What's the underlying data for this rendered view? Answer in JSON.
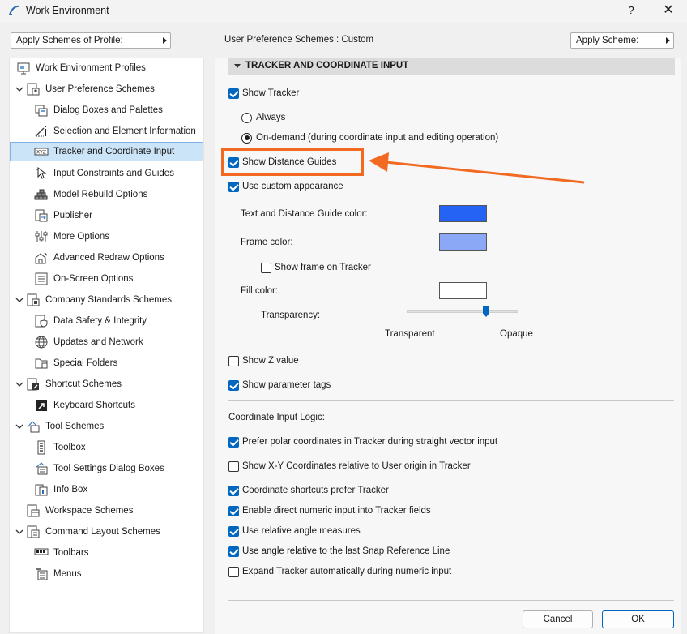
{
  "window": {
    "title": "Work Environment",
    "help_label": "?",
    "close_label": "✕"
  },
  "toolbar": {
    "apply_profile_label": "Apply Schemes of Profile:",
    "scheme_label": "User Preference Schemes :  Custom",
    "apply_scheme_label": "Apply Scheme:"
  },
  "tree": {
    "items": [
      {
        "label": "Work Environment Profiles",
        "icon": "profiles-icon"
      },
      {
        "label": "User Preference Schemes",
        "icon": "user-preference-icon"
      },
      {
        "label": "Dialog Boxes and Palettes",
        "icon": "dialog-boxes-icon"
      },
      {
        "label": "Selection and Element Information",
        "icon": "selection-info-icon"
      },
      {
        "label": "Tracker and Coordinate Input",
        "icon": "xyz-icon"
      },
      {
        "label": "Input Constraints and Guides",
        "icon": "input-constraints-icon"
      },
      {
        "label": "Model Rebuild Options",
        "icon": "model-rebuild-icon"
      },
      {
        "label": "Publisher",
        "icon": "publisher-icon"
      },
      {
        "label": "More Options",
        "icon": "more-options-icon"
      },
      {
        "label": "Advanced Redraw Options",
        "icon": "advanced-redraw-icon"
      },
      {
        "label": "On-Screen Options",
        "icon": "on-screen-icon"
      },
      {
        "label": "Company Standards Schemes",
        "icon": "company-standards-icon"
      },
      {
        "label": "Data Safety & Integrity",
        "icon": "data-safety-icon"
      },
      {
        "label": "Updates and Network",
        "icon": "globe-icon"
      },
      {
        "label": "Special Folders",
        "icon": "folder-icon"
      },
      {
        "label": "Shortcut Schemes",
        "icon": "shortcut-schemes-icon"
      },
      {
        "label": "Keyboard Shortcuts",
        "icon": "keyboard-shortcut-icon"
      },
      {
        "label": "Tool Schemes",
        "icon": "tool-schemes-icon"
      },
      {
        "label": "Toolbox",
        "icon": "toolbox-icon"
      },
      {
        "label": "Tool Settings Dialog Boxes",
        "icon": "tool-settings-icon"
      },
      {
        "label": "Info Box",
        "icon": "info-box-icon"
      },
      {
        "label": "Workspace Schemes",
        "icon": "workspace-icon"
      },
      {
        "label": "Command Layout Schemes",
        "icon": "command-layout-icon"
      },
      {
        "label": "Toolbars",
        "icon": "toolbars-icon"
      },
      {
        "label": "Menus",
        "icon": "menus-icon"
      }
    ]
  },
  "panel": {
    "section_title": "TRACKER AND COORDINATE INPUT",
    "show_tracker": {
      "label": "Show Tracker",
      "checked": true
    },
    "radio_always": {
      "label": "Always",
      "checked": false
    },
    "radio_ondemand": {
      "label": "On-demand (during coordinate input and editing operation)",
      "checked": true
    },
    "show_distance_guides": {
      "label": "Show Distance Guides",
      "checked": true
    },
    "use_custom_appearance": {
      "label": "Use custom appearance",
      "checked": true
    },
    "text_guide_color_label": "Text and Distance Guide color:",
    "frame_color_label": "Frame color:",
    "show_frame": {
      "label": "Show frame on Tracker",
      "checked": false
    },
    "fill_color_label": "Fill color:",
    "transparency_label": "Transparency:",
    "transparent_label": "Transparent",
    "opaque_label": "Opaque",
    "transparency_value": 0.7,
    "show_z": {
      "label": "Show Z value",
      "checked": false
    },
    "show_param_tags": {
      "label": "Show parameter tags",
      "checked": true
    },
    "coord_logic_label": "Coordinate Input Logic:",
    "logic_options": [
      {
        "label": "Prefer polar coordinates in Tracker during straight vector input",
        "checked": true
      },
      {
        "label": "Show X-Y Coordinates relative to User origin in Tracker",
        "checked": false
      },
      {
        "label": "Coordinate shortcuts prefer Tracker",
        "checked": true
      },
      {
        "label": "Enable direct numeric input into Tracker fields",
        "checked": true
      },
      {
        "label": "Use relative angle measures",
        "checked": true
      },
      {
        "label": "Use angle relative to the last Snap Reference Line",
        "checked": true
      },
      {
        "label": "Expand Tracker automatically during numeric input",
        "checked": false
      }
    ]
  },
  "colors": {
    "text_guide": "#2563f5",
    "frame": "#8aa8f5",
    "fill": "#ffffff",
    "accent": "#0067c0",
    "annotation": "#f26a22"
  },
  "footer": {
    "cancel_label": "Cancel",
    "ok_label": "OK"
  }
}
